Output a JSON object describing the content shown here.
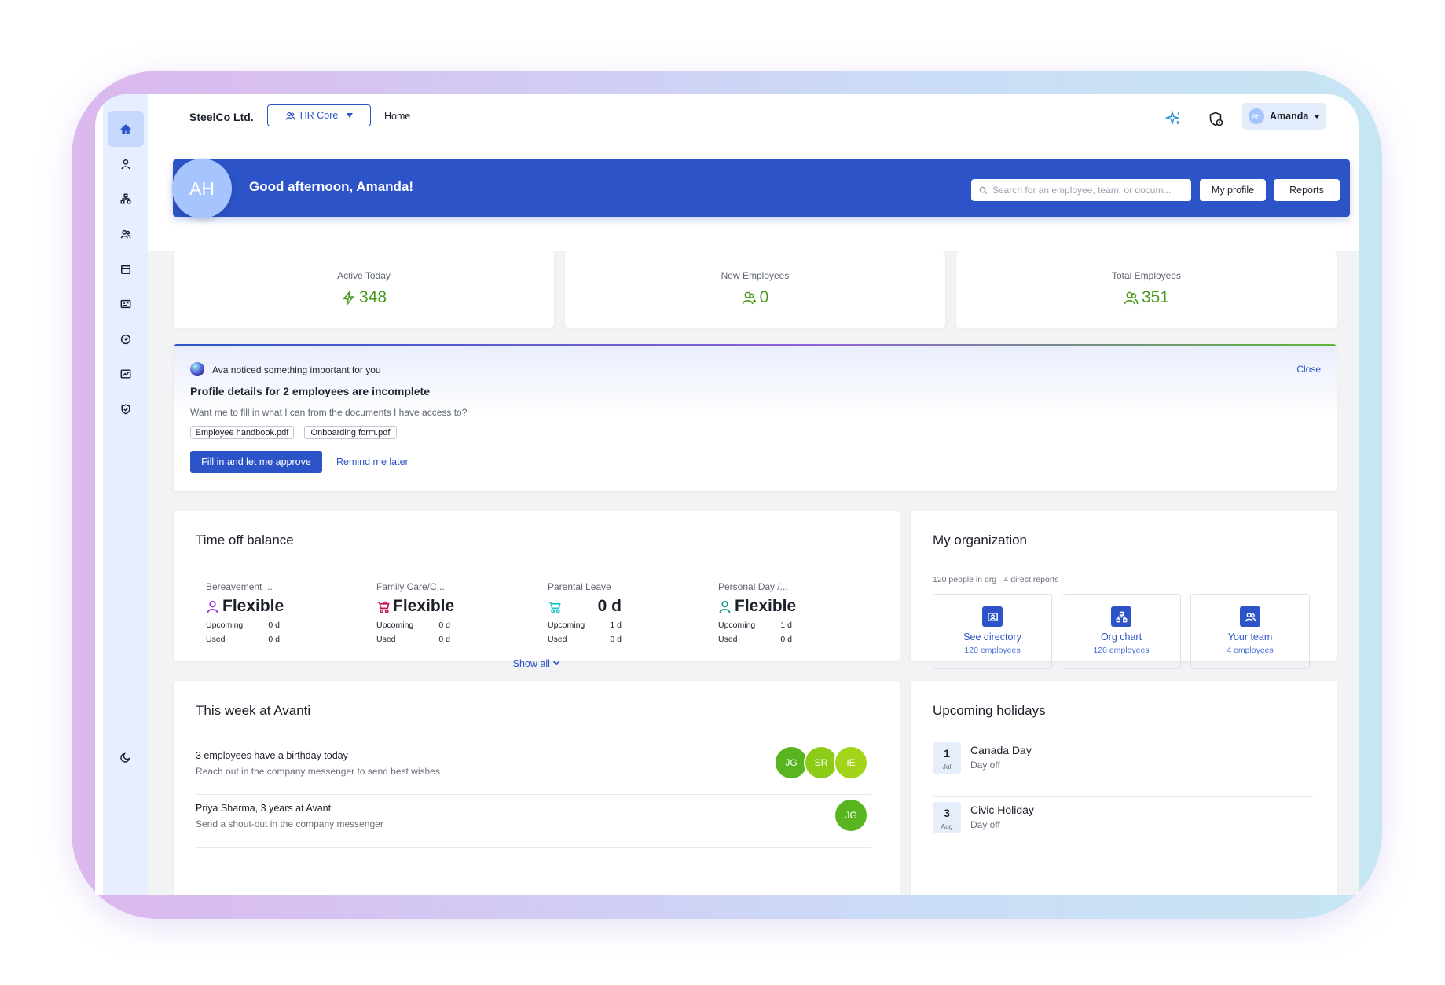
{
  "topbar": {
    "company": "SteelCo Ltd.",
    "module": "HR Core",
    "home": "Home",
    "user_initials": "AH",
    "user_name": "Amanda"
  },
  "hero": {
    "initials": "AH",
    "greeting": "Good afternoon, Amanda!",
    "search_placeholder": "Search for an employee, team, or docum...",
    "my_profile": "My profile",
    "reports": "Reports"
  },
  "stats": [
    {
      "label": "Active Today",
      "value": "348",
      "icon": "lightning-icon"
    },
    {
      "label": "New Employees",
      "value": "0",
      "icon": "user-add-icon"
    },
    {
      "label": "Total Employees",
      "value": "351",
      "icon": "users-icon"
    }
  ],
  "ava": {
    "title": "Ava noticed something important for you",
    "close": "Close",
    "heading": "Profile details for 2 employees are incomplete",
    "question": "Want me to fill in what I can from the documents I have access to?",
    "docs": [
      "Employee handbook.pdf",
      "Onboarding form.pdf"
    ],
    "primary": "Fill in and let me approve",
    "secondary": "Remind me later"
  },
  "timeoff": {
    "title": "Time off balance",
    "upcoming_label": "Upcoming",
    "used_label": "Used",
    "items": [
      {
        "type": "Bereavement ...",
        "value": "Flexible",
        "upcoming": "0 d",
        "used": "0 d",
        "icon": "person-icon",
        "color": "#a233d6"
      },
      {
        "type": "Family Care/C...",
        "value": "Flexible",
        "upcoming": "0 d",
        "used": "0 d",
        "icon": "stroller-icon",
        "color": "#c2185b"
      },
      {
        "type": "Parental Leave",
        "value": "0 d",
        "upcoming": "1 d",
        "used": "0 d",
        "icon": "baby-carriage-icon",
        "color": "#1fc6c6"
      },
      {
        "type": "Personal Day /...",
        "value": "Flexible",
        "upcoming": "1 d",
        "used": "0 d",
        "icon": "person-icon",
        "color": "#169c8a"
      }
    ],
    "show_all": "Show all"
  },
  "org": {
    "title": "My organization",
    "summary": "120 people in org · 4 direct reports",
    "tiles": [
      {
        "name": "See directory",
        "sub": "120 employees",
        "icon": "directory-icon"
      },
      {
        "name": "Org chart",
        "sub": "120 employees",
        "icon": "org-chart-icon"
      },
      {
        "name": "Your team",
        "sub": "4 employees",
        "icon": "team-icon"
      }
    ]
  },
  "week": {
    "title": "This week at Avanti",
    "items": [
      {
        "title": "3 employees have a birthday today",
        "sub": "Reach out in the company messenger to send best wishes",
        "avatars": [
          "JG",
          "SR",
          "IE"
        ]
      },
      {
        "title": "Priya Sharma, 3 years at Avanti",
        "sub": "Send a shout-out in the company messenger",
        "avatars": [
          "JG"
        ]
      }
    ]
  },
  "holidays": {
    "title": "Upcoming holidays",
    "items": [
      {
        "day": "1",
        "month": "Jul",
        "name": "Canada Day",
        "sub": "Day off"
      },
      {
        "day": "3",
        "month": "Aug",
        "name": "Civic Holiday",
        "sub": "Day off"
      }
    ]
  },
  "colors": {
    "accent": "#2c54c8",
    "stat_green": "#4c9a1e",
    "avatar_green_1": "#58b51f",
    "avatar_green_2": "#8ccc18",
    "avatar_green_3": "#a4d41a"
  }
}
